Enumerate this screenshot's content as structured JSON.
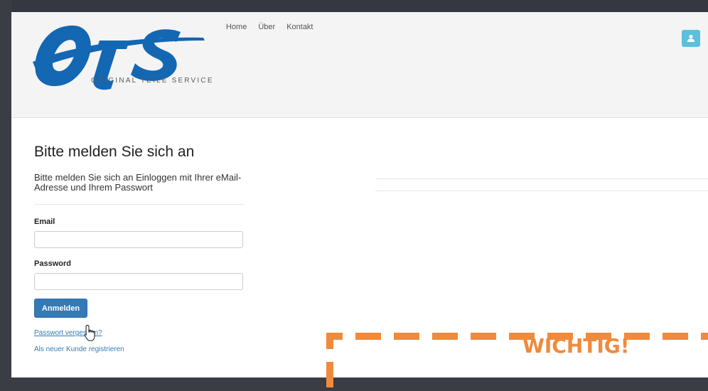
{
  "brand": {
    "subtitle": "ORIGINAL TEILE SERVICE",
    "logo_text": "OTS",
    "logo_color": "#1467b2"
  },
  "nav": {
    "items": [
      "Home",
      "Über",
      "Kontakt"
    ]
  },
  "user_menu": {
    "icon": "user-icon",
    "color": "#5bc0de"
  },
  "login": {
    "title": "Bitte melden Sie sich an",
    "subtitle": "Bitte melden Sie sich an Einloggen mit Ihrer eMail-Adresse und Ihrem Passwort",
    "email_label": "Email",
    "email_value": "",
    "password_label": "Password",
    "password_value": "",
    "submit_label": "Anmelden",
    "forgot_link": "Passwort vergessen?",
    "register_link": "Als neuer Kunde registrieren"
  },
  "callout": {
    "title": "WICHTIG!",
    "color": "#f08a3c"
  },
  "colors": {
    "primary": "#337ab7",
    "background": "#3a3d44"
  }
}
